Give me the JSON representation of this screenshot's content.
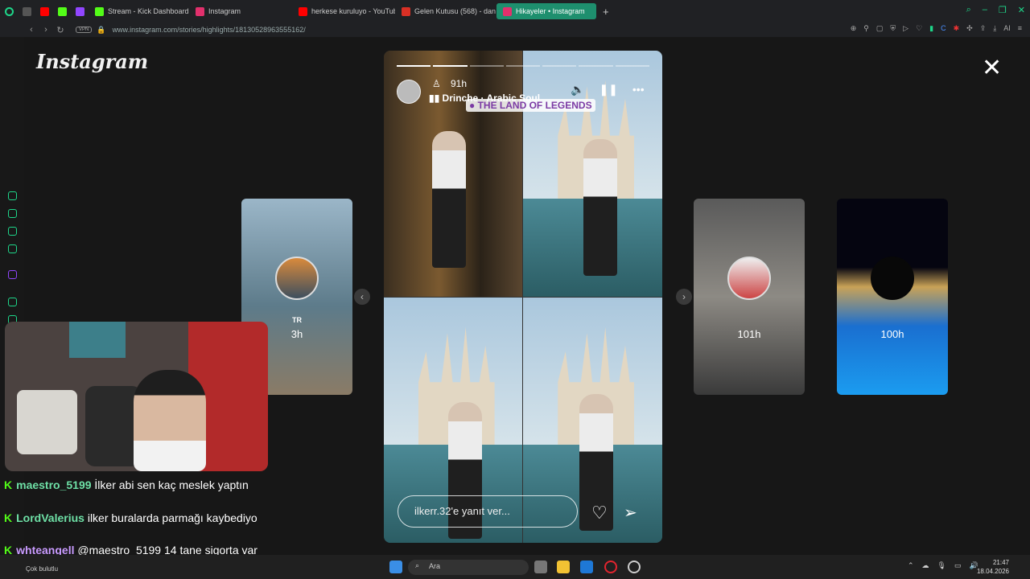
{
  "browser": {
    "tabs": [
      {
        "label": "Stream - Kick Dashboard",
        "color": "#53fc18"
      },
      {
        "label": "Instagram",
        "color": "#e1306c"
      },
      {
        "label": "herkese kuruluyo - YouTub",
        "color": "#ff0000"
      },
      {
        "label": "Gelen Kutusu (568) - dan",
        "color": "#d93025"
      },
      {
        "label": "Hikayeler • Instagram",
        "color": "#e1306c"
      }
    ],
    "new_tab": "+",
    "vpn": "VPN",
    "url": "www.instagram.com/stories/highlights/18130528963555162/",
    "ai_label": "AI"
  },
  "instagram": {
    "logo": "Instagram",
    "story": {
      "time": "91h",
      "music": "Drinche · Arabic Soul",
      "location": "THE LAND OF LEGENDS",
      "reply_placeholder": "ilkerr.32'e yanıt ver...",
      "progress_total": 7,
      "progress_done": 2
    },
    "side_stories": [
      {
        "name": "TR",
        "time": "3h"
      },
      {
        "name": "",
        "time": "101h"
      },
      {
        "name": "",
        "time": "100h"
      }
    ]
  },
  "chat": [
    {
      "user": "maestro_5199",
      "message": "İlker abi sen kaç meslek yaptın"
    },
    {
      "user": "LordValerius",
      "message": "ilker buralarda parmağı kaybediyo"
    },
    {
      "user": "whteangell",
      "message": "@maestro_5199 14 tane sigorta var"
    }
  ],
  "taskbar": {
    "search": "Ara",
    "weather": "Çok bulutlu",
    "time": "21:47",
    "date": "18.04.2026"
  }
}
